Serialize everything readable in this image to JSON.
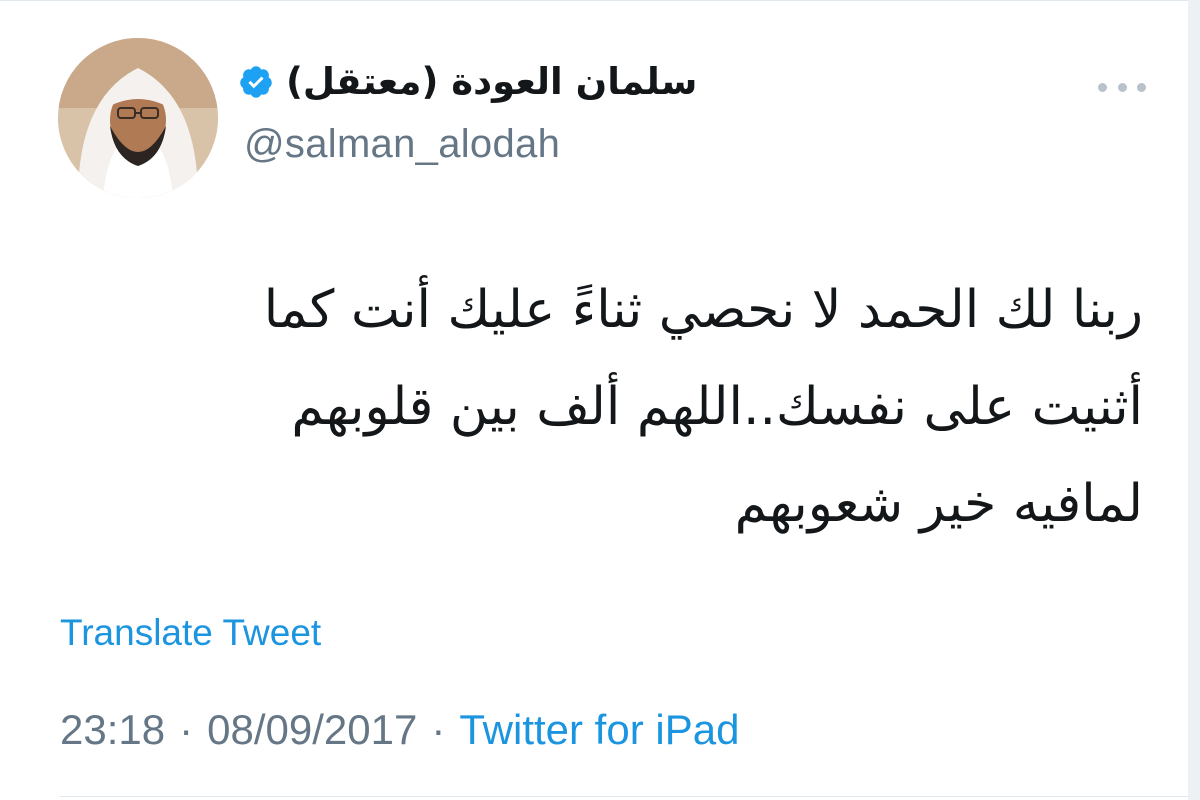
{
  "author": {
    "display_name": "سلمان العودة (معتقل)",
    "handle": "@salman_alodah",
    "verified": true,
    "avatar_icon": "profile-photo"
  },
  "tweet": {
    "lines": [
      "ربنا لك الحمد لا نحصي ثناءً عليك أنت كما",
      "أثنيت على نفسك..اللهم ألف بين قلوبهم",
      "لمافيه خير شعوبهم"
    ],
    "translate_label": "Translate Tweet"
  },
  "meta": {
    "time": "23:18",
    "date": "08/09/2017",
    "separator": "·",
    "source": "Twitter for iPad"
  },
  "icons": {
    "more": "more-dots-icon",
    "verified": "verified-badge-icon"
  },
  "colors": {
    "link": "#1b95e0",
    "verified": "#1da1f2",
    "muted": "#657786",
    "text": "#14171a"
  }
}
